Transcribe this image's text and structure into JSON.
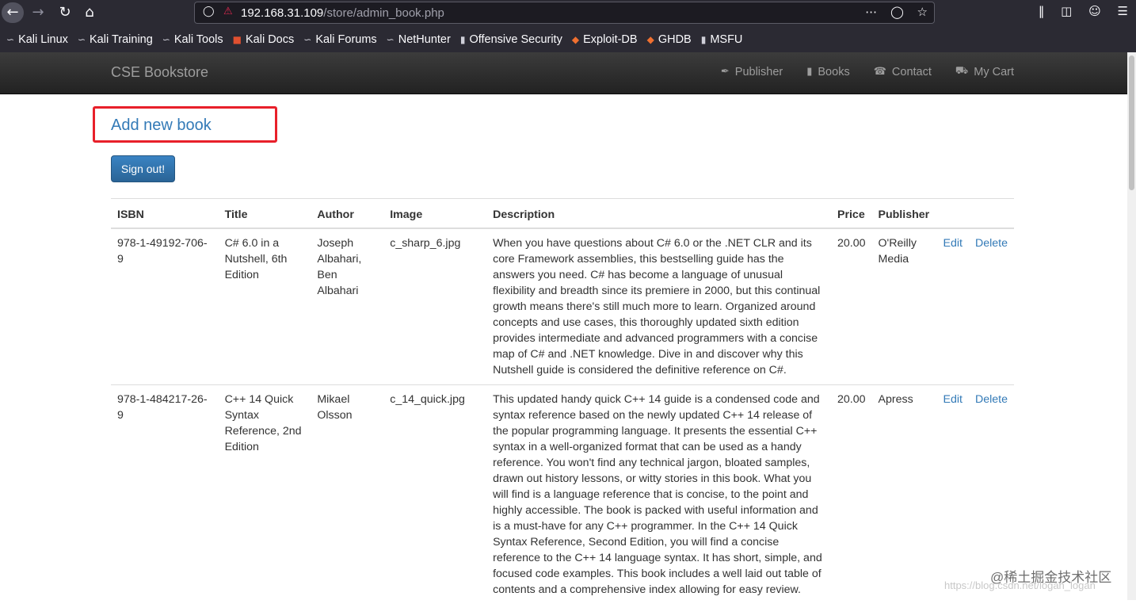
{
  "browser": {
    "url_host": "192.168.31.109",
    "url_path": "/store/admin_book.php",
    "bookmarks": [
      "Kali Linux",
      "Kali Training",
      "Kali Tools",
      "Kali Docs",
      "Kali Forums",
      "NetHunter",
      "Offensive Security",
      "Exploit-DB",
      "GHDB",
      "MSFU"
    ]
  },
  "site": {
    "brand": "CSE Bookstore",
    "nav": [
      {
        "label": "Publisher",
        "icon": "paperclip-icon"
      },
      {
        "label": "Books",
        "icon": "book-icon"
      },
      {
        "label": "Contact",
        "icon": "phone-icon"
      },
      {
        "label": "My Cart",
        "icon": "cart-icon"
      }
    ]
  },
  "page": {
    "add_link": "Add new book",
    "signout": "Sign out!",
    "headers": [
      "ISBN",
      "Title",
      "Author",
      "Image",
      "Description",
      "Price",
      "Publisher"
    ],
    "edit_label": "Edit",
    "delete_label": "Delete",
    "rows": [
      {
        "isbn": "978-1-49192-706-9",
        "title": "C# 6.0 in a Nutshell, 6th Edition",
        "author": "Joseph Albahari, Ben Albahari",
        "image": "c_sharp_6.jpg",
        "description": "When you have questions about C# 6.0 or the .NET CLR and its core Framework assemblies, this bestselling guide has the answers you need. C# has become a language of unusual flexibility and breadth since its premiere in 2000, but this continual growth means there's still much more to learn. Organized around concepts and use cases, this thoroughly updated sixth edition provides intermediate and advanced programmers with a concise map of C# and .NET knowledge. Dive in and discover why this Nutshell guide is considered the definitive reference on C#.",
        "price": "20.00",
        "publisher": "O'Reilly Media"
      },
      {
        "isbn": "978-1-484217-26-9",
        "title": "C++ 14 Quick Syntax Reference, 2nd Edition",
        "author": "Mikael Olsson",
        "image": "c_14_quick.jpg",
        "description": "This updated handy quick C++ 14 guide is a condensed code and syntax reference based on the newly updated C++ 14 release of the popular programming language. It presents the essential C++ syntax in a well-organized format that can be used as a handy reference. You won't find any technical jargon, bloated samples, drawn out history lessons, or witty stories in this book. What you will find is a language reference that is concise, to the point and highly accessible. The book is packed with useful information and is a must-have for any C++ programmer. In the C++ 14 Quick Syntax Reference, Second Edition, you will find a concise reference to the C++ 14 language syntax. It has short, simple, and focused code examples. This book includes a well laid out table of contents and a comprehensive index allowing for easy review.",
        "price": "20.00",
        "publisher": "Apress"
      }
    ]
  },
  "watermark": {
    "text": "@稀土掘金技术社区",
    "url": "https://blog.csdn.net/logan_logan"
  },
  "colors": {
    "link": "#337ab7",
    "highlight": "#e8202a",
    "navbar": "#222222"
  }
}
